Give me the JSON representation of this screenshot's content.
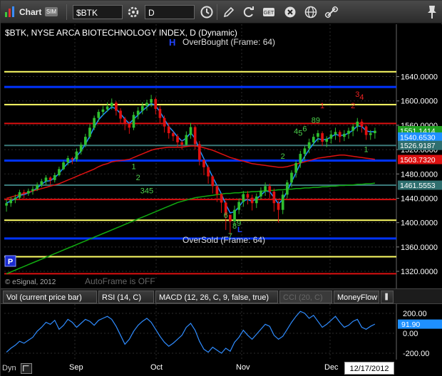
{
  "toolbar": {
    "app_label": "Chart",
    "symbol_value": "$BTK",
    "interval_value": "D"
  },
  "chart": {
    "title": "$BTK, NYSE ARCA BIOTECHNOLOGY INDEX, D (Dynamic)",
    "overbought_label": "OverBought (Frame: 64)",
    "oversold_label": "OverSold (Frame: 64)",
    "autoframe_label": "AutoFrame is OFF",
    "copyright": "© eSignal, 2012",
    "p_button": "P",
    "h_marker": "H",
    "l_marker": "L"
  },
  "chart_data": [
    {
      "type": "candlestick",
      "title": "$BTK, NYSE ARCA BIOTECHNOLOGY INDEX, D (Dynamic)",
      "x_ticks": [
        "Sep",
        "Oct",
        "Nov",
        "Dec"
      ],
      "y_ticks": [
        "1320.0000",
        "1360.0000",
        "1400.0000",
        "1440.0000",
        "1480.0000",
        "1520.0000",
        "1560.0000",
        "1600.0000",
        "1640.0000"
      ],
      "ylim": [
        1305,
        1665
      ],
      "last_date": "12/17/2012",
      "closes": [
        1432,
        1438,
        1441,
        1450,
        1448,
        1452,
        1455,
        1462,
        1468,
        1474,
        1470,
        1478,
        1488,
        1499,
        1506,
        1504,
        1517,
        1528,
        1541,
        1556,
        1572,
        1582,
        1586,
        1591,
        1597,
        1584,
        1571,
        1562,
        1556,
        1577,
        1584,
        1592,
        1597,
        1603,
        1587,
        1572,
        1558,
        1547,
        1542,
        1532,
        1528,
        1544,
        1557,
        1529,
        1503,
        1491,
        1476,
        1460,
        1447,
        1433,
        1413,
        1402,
        1421,
        1434,
        1447,
        1441,
        1432,
        1443,
        1452,
        1460,
        1451,
        1432,
        1421,
        1446,
        1466,
        1482,
        1498,
        1513,
        1522,
        1532,
        1541,
        1547,
        1533,
        1538,
        1545,
        1549,
        1541,
        1546,
        1551,
        1558,
        1566,
        1558,
        1544,
        1547,
        1551
      ],
      "highs_lows": [
        [
          1418,
          1438
        ],
        [
          1426,
          1442
        ],
        [
          1432,
          1446
        ],
        [
          1438,
          1454
        ],
        [
          1440,
          1454
        ],
        [
          1444,
          1456
        ],
        [
          1446,
          1460
        ],
        [
          1452,
          1466
        ],
        [
          1458,
          1472
        ],
        [
          1462,
          1478
        ],
        [
          1462,
          1476
        ],
        [
          1466,
          1482
        ],
        [
          1476,
          1492
        ],
        [
          1486,
          1502
        ],
        [
          1494,
          1510
        ],
        [
          1496,
          1508
        ],
        [
          1500,
          1522
        ],
        [
          1512,
          1532
        ],
        [
          1524,
          1546
        ],
        [
          1538,
          1562
        ],
        [
          1552,
          1576
        ],
        [
          1566,
          1586
        ],
        [
          1576,
          1592
        ],
        [
          1582,
          1598
        ],
        [
          1586,
          1604
        ],
        [
          1576,
          1600
        ],
        [
          1562,
          1588
        ],
        [
          1552,
          1574
        ],
        [
          1546,
          1566
        ],
        [
          1552,
          1582
        ],
        [
          1570,
          1590
        ],
        [
          1578,
          1598
        ],
        [
          1584,
          1602
        ],
        [
          1590,
          1610
        ],
        [
          1578,
          1606
        ],
        [
          1564,
          1592
        ],
        [
          1548,
          1576
        ],
        [
          1538,
          1562
        ],
        [
          1534,
          1550
        ],
        [
          1524,
          1546
        ],
        [
          1520,
          1536
        ],
        [
          1526,
          1550
        ],
        [
          1538,
          1564
        ],
        [
          1520,
          1560
        ],
        [
          1494,
          1534
        ],
        [
          1478,
          1504
        ],
        [
          1464,
          1494
        ],
        [
          1448,
          1478
        ],
        [
          1434,
          1462
        ],
        [
          1416,
          1448
        ],
        [
          1388,
          1436
        ],
        [
          1380,
          1412
        ],
        [
          1396,
          1428
        ],
        [
          1414,
          1440
        ],
        [
          1426,
          1452
        ],
        [
          1430,
          1452
        ],
        [
          1420,
          1446
        ],
        [
          1424,
          1448
        ],
        [
          1438,
          1458
        ],
        [
          1444,
          1466
        ],
        [
          1440,
          1464
        ],
        [
          1418,
          1456
        ],
        [
          1400,
          1436
        ],
        [
          1414,
          1452
        ],
        [
          1440,
          1470
        ],
        [
          1458,
          1486
        ],
        [
          1474,
          1502
        ],
        [
          1490,
          1518
        ],
        [
          1502,
          1526
        ],
        [
          1514,
          1538
        ],
        [
          1526,
          1546
        ],
        [
          1532,
          1552
        ],
        [
          1526,
          1550
        ],
        [
          1524,
          1542
        ],
        [
          1530,
          1552
        ],
        [
          1536,
          1556
        ],
        [
          1532,
          1552
        ],
        [
          1534,
          1552
        ],
        [
          1538,
          1556
        ],
        [
          1542,
          1562
        ],
        [
          1550,
          1572
        ],
        [
          1548,
          1570
        ],
        [
          1536,
          1560
        ],
        [
          1536,
          1552
        ],
        [
          1538,
          1556
        ]
      ],
      "moving_averages": [
        {
          "color": "#1e90ff",
          "values": [
            1432,
            1436,
            1439,
            1445,
            1446,
            1449,
            1452,
            1457,
            1463,
            1468,
            1469,
            1474,
            1481,
            1490,
            1498,
            1501,
            1509,
            1518,
            1529,
            1542,
            1557,
            1569,
            1577,
            1584,
            1590,
            1587,
            1579,
            1570,
            1563,
            1570,
            1577,
            1584,
            1590,
            1596,
            1592,
            1582,
            1570,
            1558,
            1550,
            1541,
            1534,
            1539,
            1548,
            1538,
            1520,
            1505,
            1490,
            1475,
            1461,
            1447,
            1430,
            1416,
            1418,
            1426,
            1436,
            1438,
            1435,
            1439,
            1445,
            1452,
            1451,
            1441,
            1431,
            1438,
            1452,
            1467,
            1482,
            1497,
            1509,
            1520,
            1530,
            1538,
            1536,
            1537,
            1541,
            1545,
            1543,
            1544,
            1547,
            1552,
            1559,
            1558,
            1551,
            1549,
            1550
          ]
        },
        {
          "color": "#dd1111",
          "values": [
            1440,
            1442,
            1444,
            1446,
            1448,
            1450,
            1452,
            1454,
            1456,
            1458,
            1460,
            1462,
            1464,
            1467,
            1470,
            1473,
            1476,
            1479,
            1482,
            1485,
            1488,
            1492,
            1495,
            1497,
            1500,
            1501,
            1502,
            1503,
            1504,
            1507,
            1510,
            1513,
            1516,
            1519,
            1521,
            1522,
            1523,
            1524,
            1524,
            1524,
            1524,
            1525,
            1526,
            1526,
            1525,
            1523,
            1521,
            1519,
            1516,
            1513,
            1510,
            1507,
            1505,
            1503,
            1501,
            1499,
            1497,
            1496,
            1495,
            1494,
            1493,
            1492,
            1491,
            1491,
            1492,
            1494,
            1496,
            1498,
            1500,
            1502,
            1504,
            1506,
            1507,
            1508,
            1509,
            1510,
            1511,
            1511,
            1510,
            1509,
            1508,
            1507,
            1506,
            1505,
            1504
          ]
        },
        {
          "color": "#11aa11",
          "values": [
            1316,
            1319,
            1322,
            1325,
            1328,
            1331,
            1334,
            1337,
            1340,
            1343,
            1346,
            1349,
            1352,
            1355,
            1358,
            1361,
            1364,
            1367,
            1370,
            1373,
            1376,
            1379,
            1382,
            1385,
            1388,
            1391,
            1394,
            1397,
            1400,
            1403,
            1406,
            1409,
            1412,
            1415,
            1418,
            1421,
            1424,
            1427,
            1430,
            1433,
            1435,
            1437,
            1439,
            1441,
            1442,
            1443,
            1444,
            1445,
            1446,
            1447,
            1448,
            1448,
            1449,
            1449,
            1450,
            1450,
            1451,
            1451,
            1452,
            1452,
            1453,
            1453,
            1454,
            1454,
            1455,
            1455,
            1456,
            1456,
            1457,
            1457,
            1458,
            1458,
            1459,
            1459,
            1460,
            1460,
            1461,
            1461,
            1462,
            1462,
            1463,
            1463,
            1464,
            1464,
            1465
          ]
        }
      ],
      "horizontal_lines": [
        {
          "y": 1648,
          "color": "#ffff66"
        },
        {
          "y": 1623,
          "color": "#0033ff"
        },
        {
          "y": 1594,
          "color": "#ffff66"
        },
        {
          "y": 1563,
          "color": "#dd1111"
        },
        {
          "y": 1526.9187,
          "color": "#3a7a7a"
        },
        {
          "y": 1502,
          "color": "#0033ff"
        },
        {
          "y": 1461.5553,
          "color": "#3a7a7a"
        },
        {
          "y": 1438,
          "color": "#dd1111"
        },
        {
          "y": 1404,
          "color": "#ffff66"
        },
        {
          "y": 1374,
          "color": "#0033ff"
        },
        {
          "y": 1344,
          "color": "#ffff66"
        },
        {
          "y": 1316,
          "color": "#dd1111"
        }
      ],
      "price_labels": [
        {
          "text": "1551.1414",
          "value": 1551.1414,
          "bg": "#1fa01f",
          "fg": "#ffffff"
        },
        {
          "text": "1540.6530",
          "value": 1540.653,
          "bg": "#1e90ff",
          "fg": "#ffffff"
        },
        {
          "text": "1526.9187",
          "value": 1526.9187,
          "bg": "#2f6f6f",
          "fg": "#ffffff"
        },
        {
          "text": "1503.7320",
          "value": 1503.732,
          "bg": "#dd1111",
          "fg": "#ffffff"
        },
        {
          "text": "1461.5553",
          "value": 1461.5553,
          "bg": "#2f6f6f",
          "fg": "#ffffff"
        }
      ],
      "sequence_labels": [
        {
          "text": "1",
          "bar": 29,
          "value": 1488,
          "color": "#4cd04c"
        },
        {
          "text": "2",
          "bar": 30,
          "value": 1470,
          "color": "#4cd04c"
        },
        {
          "text": "3",
          "bar": 31,
          "value": 1448,
          "color": "#4cd04c"
        },
        {
          "text": "4",
          "bar": 32,
          "value": 1448,
          "color": "#4cd04c"
        },
        {
          "text": "5",
          "bar": 33,
          "value": 1448,
          "color": "#4cd04c"
        },
        {
          "text": "6",
          "bar": 50,
          "value": 1408,
          "color": "#4cd04c"
        },
        {
          "text": "7",
          "bar": 51,
          "value": 1374,
          "color": "#4cd04c"
        },
        {
          "text": "8",
          "bar": 52,
          "value": 1390,
          "color": "#4cd04c"
        },
        {
          "text": "9",
          "bar": 53,
          "value": 1395,
          "color": "#4cd04c"
        },
        {
          "text": "2",
          "bar": 63,
          "value": 1505,
          "color": "#4cd04c"
        },
        {
          "text": "4",
          "bar": 66,
          "value": 1546,
          "color": "#4cd04c"
        },
        {
          "text": "5",
          "bar": 67,
          "value": 1543,
          "color": "#4cd04c"
        },
        {
          "text": "6",
          "bar": 68,
          "value": 1550,
          "color": "#4cd04c"
        },
        {
          "text": "8",
          "bar": 70,
          "value": 1564,
          "color": "#4cd04c"
        },
        {
          "text": "9",
          "bar": 71,
          "value": 1564,
          "color": "#4cd04c"
        },
        {
          "text": "1",
          "bar": 82,
          "value": 1516,
          "color": "#4cd04c"
        },
        {
          "text": "1",
          "bar": 72,
          "value": 1588,
          "color": "#ee2222"
        },
        {
          "text": "2",
          "bar": 79,
          "value": 1588,
          "color": "#ee2222"
        },
        {
          "text": "3",
          "bar": 80,
          "value": 1607,
          "color": "#ee2222"
        },
        {
          "text": "4",
          "bar": 81,
          "value": 1602,
          "color": "#ee2222"
        }
      ]
    },
    {
      "type": "line",
      "title": "CCI (20, C)",
      "y_ticks": [
        "200.00",
        "100.00",
        "0.00",
        "-200.00"
      ],
      "ylim": [
        -260,
        270
      ],
      "last_value_label": "91.90",
      "values": [
        -190,
        -150,
        -120,
        -80,
        -100,
        -70,
        -40,
        20,
        60,
        110,
        90,
        130,
        40,
        80,
        140,
        110,
        60,
        100,
        140,
        120,
        80,
        130,
        150,
        170,
        140,
        70,
        -20,
        -110,
        -60,
        20,
        80,
        120,
        150,
        110,
        40,
        -30,
        -90,
        -130,
        -100,
        -60,
        -20,
        60,
        100,
        30,
        -80,
        -160,
        -190,
        -140,
        -170,
        -200,
        -150,
        -180,
        -90,
        -40,
        30,
        -20,
        -60,
        -10,
        40,
        90,
        70,
        -20,
        -60,
        -30,
        40,
        110,
        170,
        220,
        200,
        150,
        180,
        120,
        60,
        90,
        130,
        170,
        110,
        60,
        80,
        120,
        140,
        60,
        40,
        70,
        91.9
      ]
    }
  ],
  "indicator_tabs": [
    "Vol (current price bar)",
    "RSI (14, C)",
    "MACD (12, 26, C, 9, false, true)",
    "CCI (20, C)",
    "MoneyFlow"
  ],
  "bottom": {
    "mode": "Dyn",
    "date_label": "12/17/2012"
  },
  "colors": {
    "background": "#000000",
    "grid": "#3a3a3a",
    "axis_text": "#ffffff",
    "up_candle": "#2fbf2f",
    "down_candle": "#e01010"
  }
}
